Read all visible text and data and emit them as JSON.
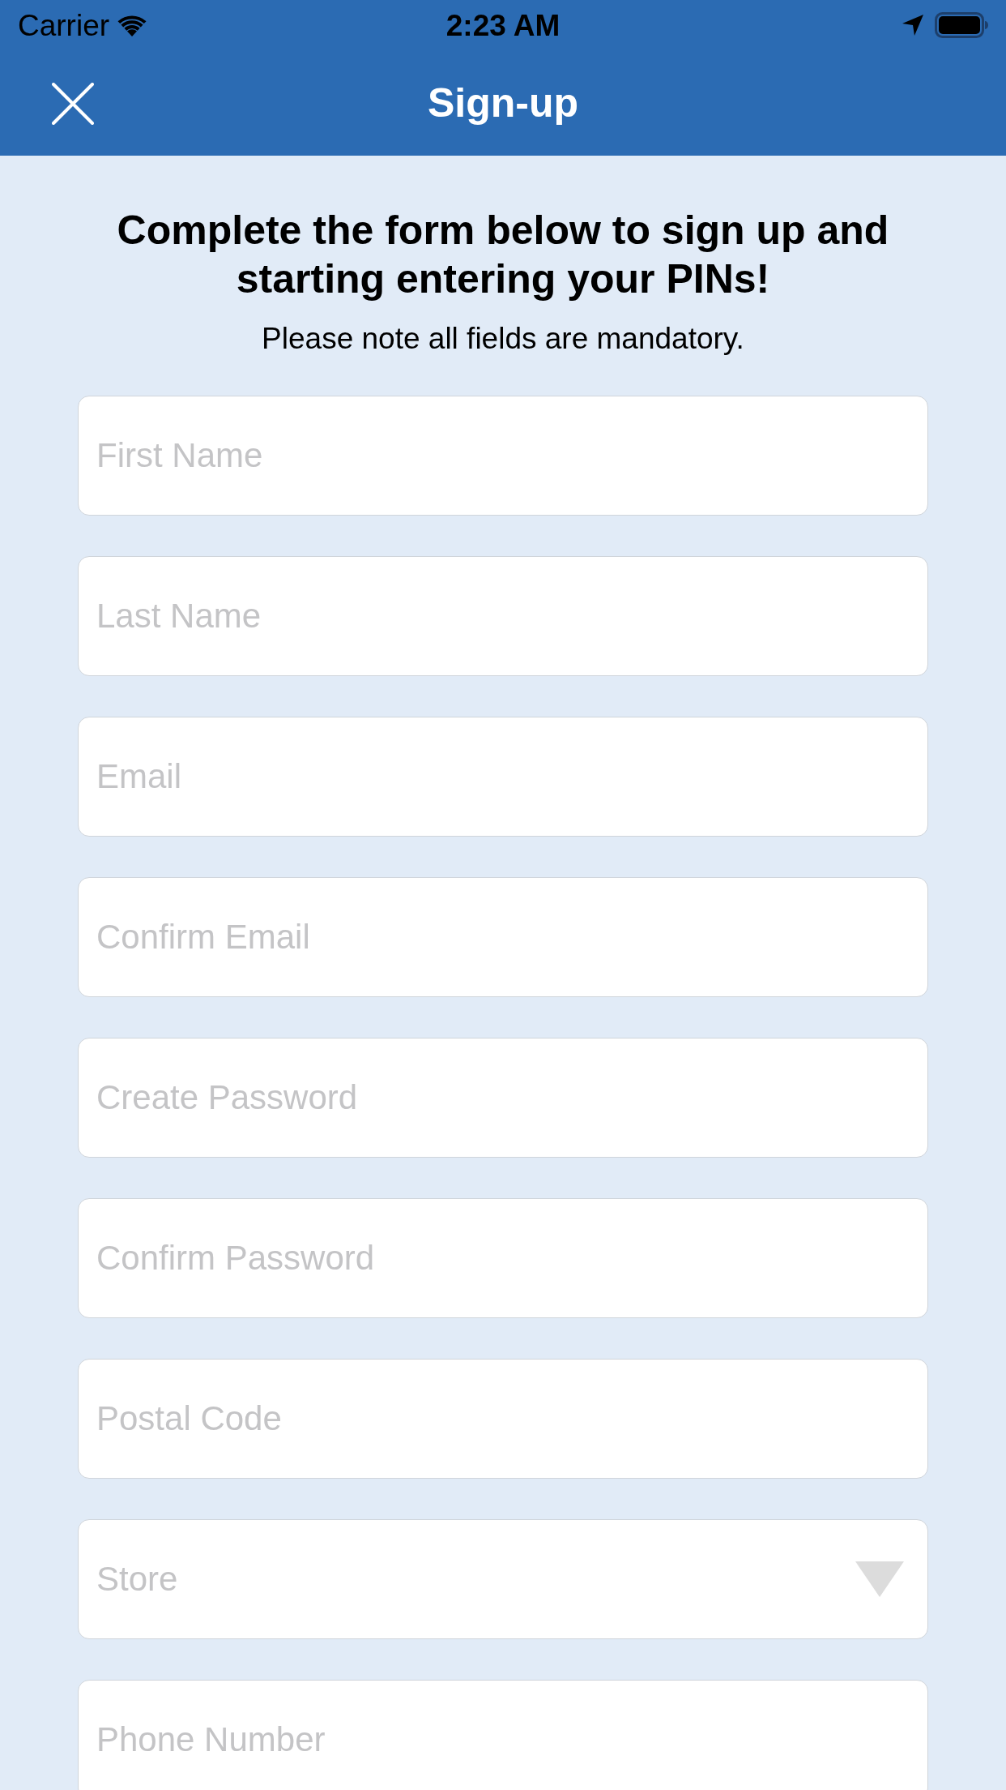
{
  "status_bar": {
    "carrier": "Carrier",
    "time": "2:23 AM"
  },
  "header": {
    "title": "Sign-up"
  },
  "intro": {
    "heading": "Complete the form below to sign up and starting entering your PINs!",
    "note": "Please note all fields are mandatory."
  },
  "fields": [
    {
      "kind": "text",
      "placeholder": "First Name"
    },
    {
      "kind": "text",
      "placeholder": "Last Name"
    },
    {
      "kind": "text",
      "placeholder": "Email"
    },
    {
      "kind": "text",
      "placeholder": "Confirm Email"
    },
    {
      "kind": "text",
      "placeholder": "Create Password"
    },
    {
      "kind": "text",
      "placeholder": "Confirm Password"
    },
    {
      "kind": "text",
      "placeholder": "Postal Code"
    },
    {
      "kind": "dropdown",
      "placeholder": "Store"
    },
    {
      "kind": "text",
      "placeholder": "Phone Number"
    }
  ]
}
